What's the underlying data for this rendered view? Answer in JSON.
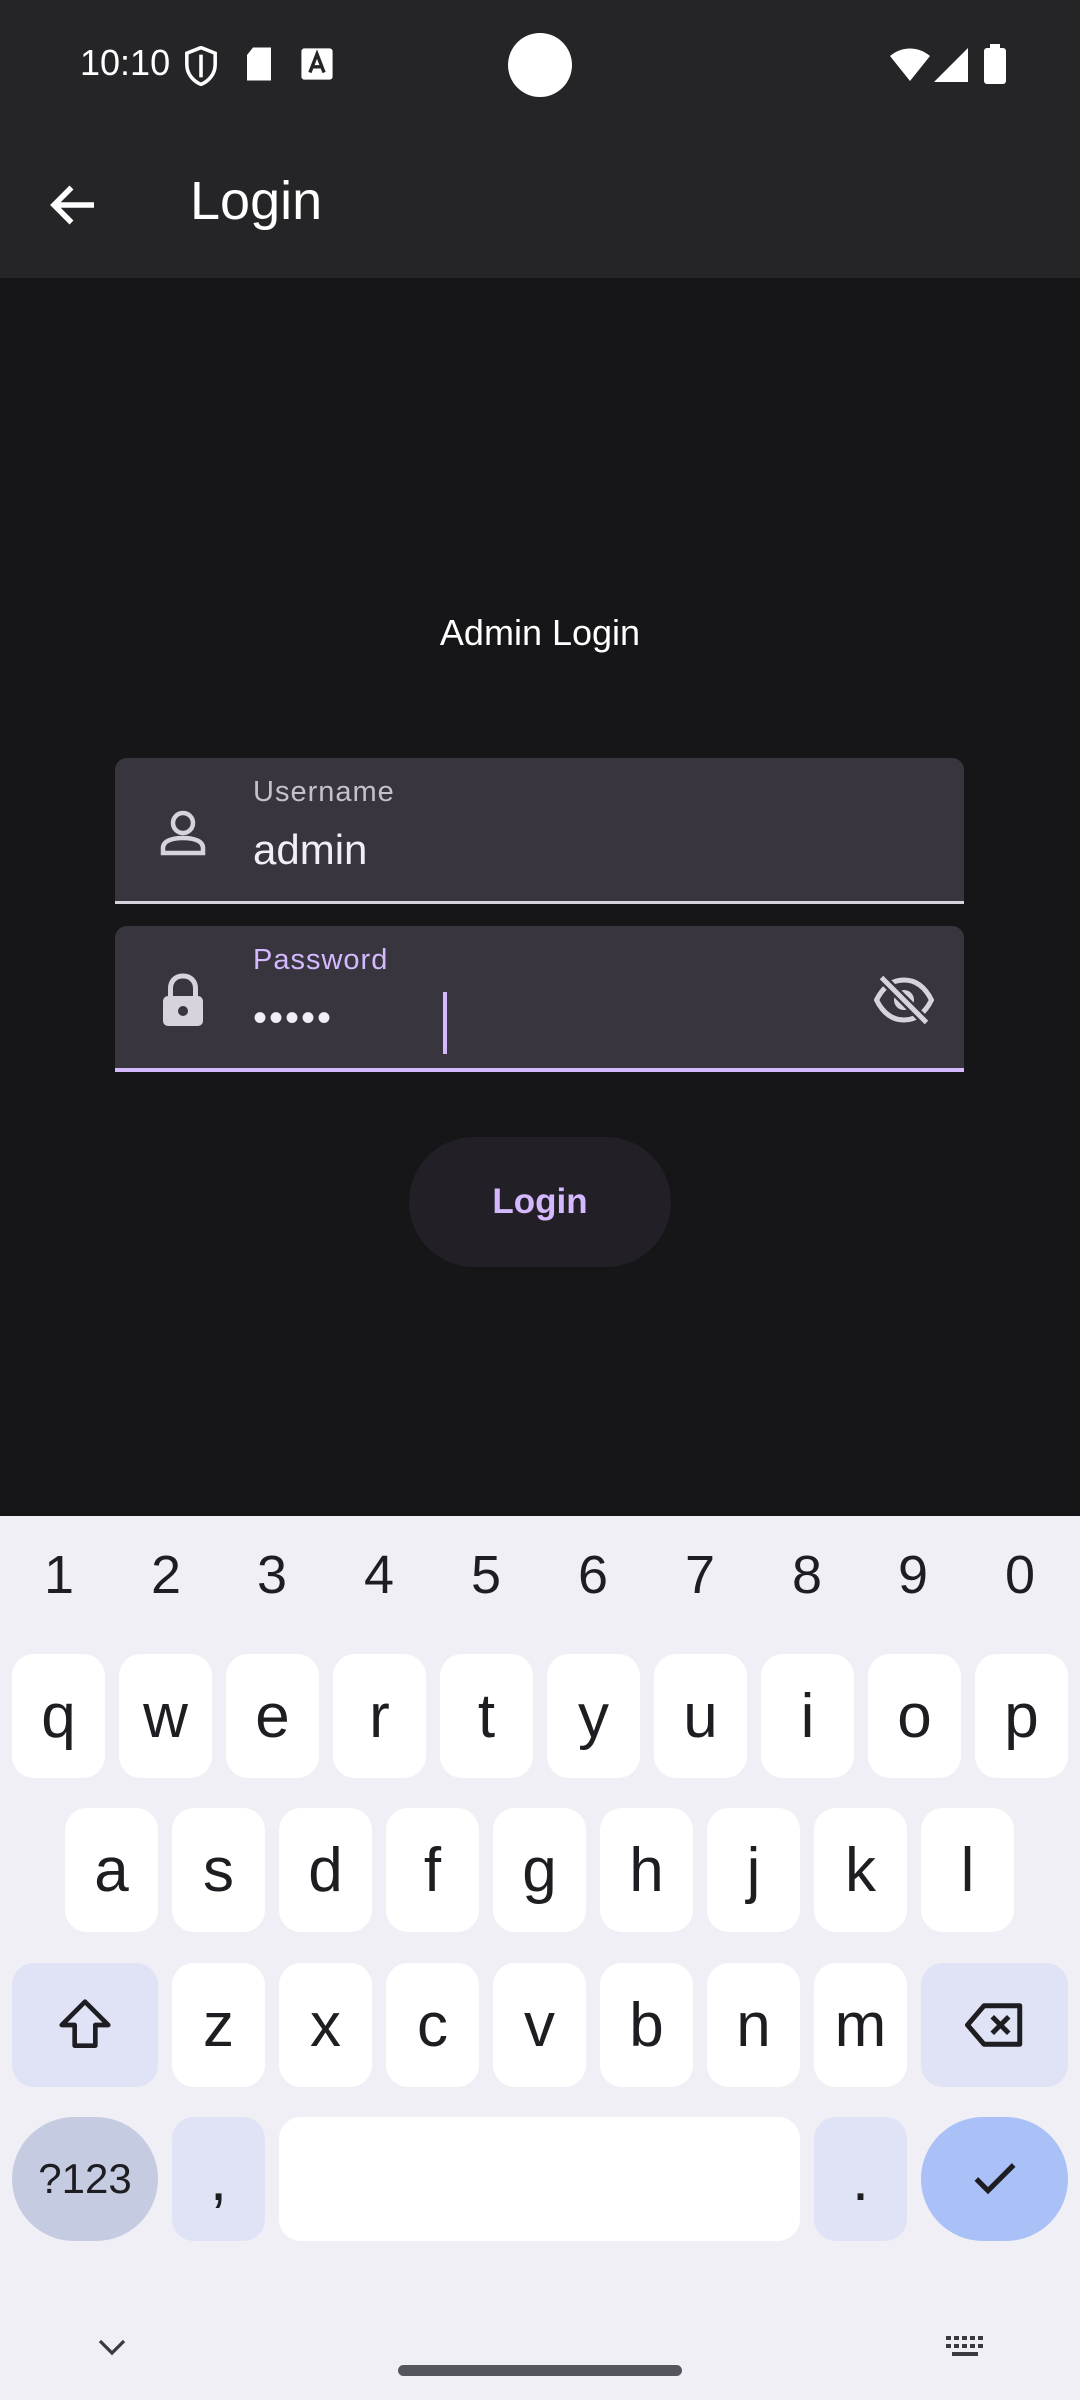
{
  "status_bar": {
    "time": "10:10"
  },
  "app_bar": {
    "title": "Login"
  },
  "form": {
    "heading": "Admin Login",
    "username": {
      "label": "Username",
      "value": "admin"
    },
    "password": {
      "label": "Password",
      "value": "•••••"
    },
    "submit_label": "Login"
  },
  "keyboard": {
    "numbers": [
      "1",
      "2",
      "3",
      "4",
      "5",
      "6",
      "7",
      "8",
      "9",
      "0"
    ],
    "row1": [
      "q",
      "w",
      "e",
      "r",
      "t",
      "y",
      "u",
      "i",
      "o",
      "p"
    ],
    "row2": [
      "a",
      "s",
      "d",
      "f",
      "g",
      "h",
      "j",
      "k",
      "l"
    ],
    "row3": [
      "z",
      "x",
      "c",
      "v",
      "b",
      "n",
      "m"
    ],
    "symbols_label": "?123",
    "comma": ",",
    "period": "."
  },
  "colors": {
    "accent": "#d4b9ff",
    "background": "#161618",
    "field": "#38353f"
  }
}
